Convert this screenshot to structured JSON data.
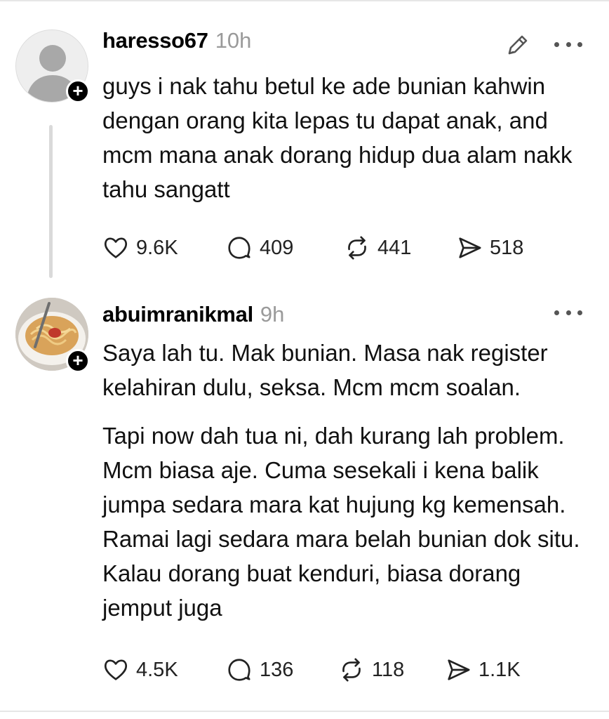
{
  "posts": [
    {
      "username": "haresso67",
      "time": "10h",
      "has_edit": true,
      "follow_badge": "+",
      "paragraphs": [
        "guys i nak tahu betul ke ade bunian kahwin dengan orang kita lepas tu dapat anak, and mcm mana anak dorang hidup dua alam nakk tahu sangatt"
      ],
      "stats": {
        "likes": "9.6K",
        "replies": "409",
        "reposts": "441",
        "shares": "518"
      }
    },
    {
      "username": "abuimranikmal",
      "time": "9h",
      "has_edit": false,
      "follow_badge": "+",
      "paragraphs": [
        "Saya lah tu. Mak bunian. Masa nak register kelahiran dulu, seksa. Mcm mcm soalan.",
        "Tapi now dah tua ni, dah kurang lah problem. Mcm biasa aje. Cuma sesekali i kena balik jumpa sedara mara kat hujung kg kemensah. Ramai lagi sedara mara belah bunian dok situ. Kalau dorang buat kenduri, biasa dorang jemput juga"
      ],
      "stats": {
        "likes": "4.5K",
        "replies": "136",
        "reposts": "118",
        "shares": "1.1K"
      }
    }
  ],
  "icons": {
    "avatar_default": "person-silhouette-icon",
    "avatar_photo": "noodle-bowl-photo",
    "edit": "pencil-icon",
    "more": "more-dots-icon",
    "like": "heart-icon",
    "reply": "speech-bubble-icon",
    "repost": "repost-arrows-icon",
    "share": "send-arrow-icon"
  },
  "colors": {
    "text": "#111111",
    "muted": "#9a9a9a",
    "divider": "#e6e6e6",
    "thread_line": "#dadada"
  }
}
